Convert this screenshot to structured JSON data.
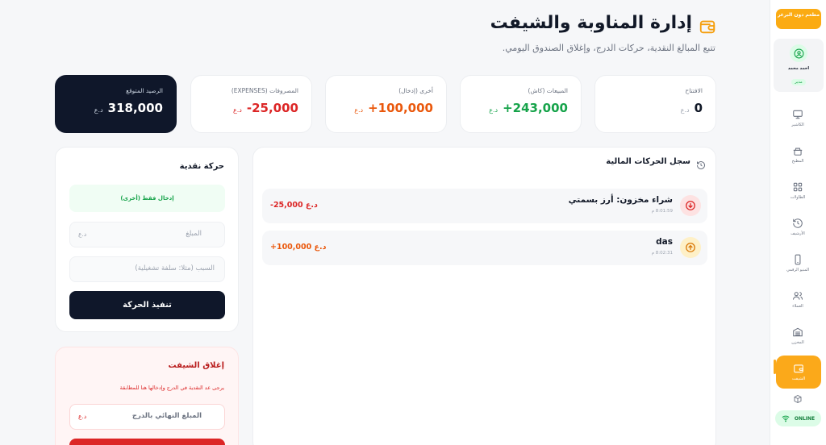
{
  "brand": {
    "name": "مطعم دون البرغر"
  },
  "user": {
    "name": "احمد محمد",
    "role": "مدير"
  },
  "nav": [
    {
      "label": "الكاشير",
      "icon": "monitor-icon"
    },
    {
      "label": "المطبخ",
      "icon": "kitchen-icon"
    },
    {
      "label": "الطاولات",
      "icon": "grid-icon"
    },
    {
      "label": "الأرشيف",
      "icon": "history-icon"
    },
    {
      "label": "المنيو الرقمي",
      "icon": "phone-icon"
    },
    {
      "label": "العملاء",
      "icon": "users-icon"
    },
    {
      "label": "المخزن",
      "icon": "warehouse-icon"
    },
    {
      "label": "الشيفت",
      "icon": "wallet-icon",
      "active": true
    }
  ],
  "status": {
    "online": "ONLINE"
  },
  "header": {
    "title": "إدارة المناوبة والشيفت",
    "subtitle": "تتبع المبالغ النقدية، حركات الدرج، وإغلاق الصندوق اليومي."
  },
  "stats": [
    {
      "label": "الافتتاح",
      "value": "0",
      "currency": "د.ع",
      "color": "#111827"
    },
    {
      "label": "المبيعات (كاش)",
      "value": "243,000+",
      "currency": "د.ع",
      "color": "#16a34a"
    },
    {
      "label": "أخرى (إدخال)",
      "value": "100,000+",
      "currency": "د.ع",
      "color": "#ea580c"
    },
    {
      "label": "المصروفات (EXPENSES)",
      "value": "25,000-",
      "currency": "د.ع",
      "color": "#dc2626"
    },
    {
      "label": "الرصيد المتوقع",
      "value": "318,000",
      "currency": "د.ع",
      "color": "#ffffff"
    }
  ],
  "ledger": {
    "title": "سجل الحركات المالية",
    "transactions": [
      {
        "name": "شراء مخزون: أرز بسمتي",
        "time": "8:01:59 م",
        "amount": "-25,000 د.ع",
        "type": "out"
      },
      {
        "name": "das",
        "time": "8:02:31 م",
        "amount": "+100,000 د.ع",
        "type": "in"
      }
    ]
  },
  "movement": {
    "title": "حركة نقدية",
    "mode": "إدخال فقط (أخرى)",
    "amount_placeholder": "المبلغ",
    "currency": "د.ع",
    "reason_placeholder": "السبب (مثلا: سلفة تشغيلية)",
    "submit": "تنفيذ الحركة"
  },
  "close_shift": {
    "title": "إغلاق الشيفت",
    "hint": "يرجى عد النقدية في الدرج وإدخالها هنا للمطابقة",
    "field_placeholder": "المبلغ النهائي بالدرج",
    "currency": "د.ع"
  }
}
